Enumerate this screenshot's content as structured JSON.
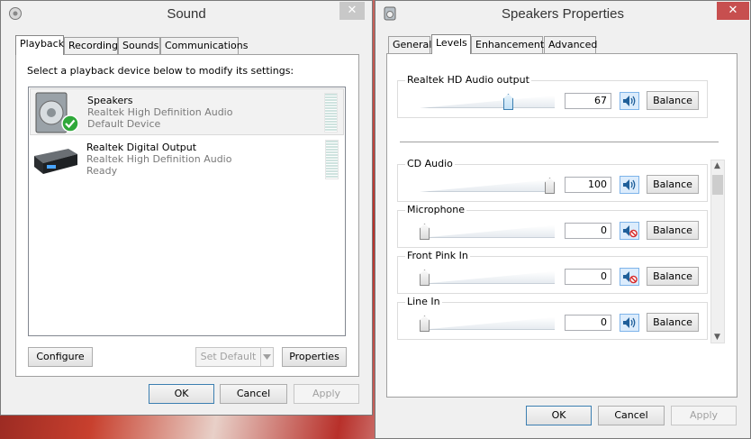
{
  "sound": {
    "title": "Sound",
    "close": "✕",
    "tabs": [
      "Playback",
      "Recording",
      "Sounds",
      "Communications"
    ],
    "instruction": "Select a playback device below to modify its settings:",
    "devices": [
      {
        "name": "Speakers",
        "line1": "Realtek High Definition Audio",
        "line2": "Default Device"
      },
      {
        "name": "Realtek Digital Output",
        "line1": "Realtek High Definition Audio",
        "line2": "Ready"
      }
    ],
    "configure": "Configure",
    "set_default": "Set Default",
    "properties": "Properties",
    "ok": "OK",
    "cancel": "Cancel",
    "apply": "Apply"
  },
  "speakers": {
    "title": "Speakers Properties",
    "close": "✕",
    "tabs": [
      "General",
      "Levels",
      "Enhancements",
      "Advanced"
    ],
    "controls": [
      {
        "label": "Realtek HD Audio output",
        "value": "67",
        "level": 0.67,
        "muted": false,
        "balance": "Balance"
      },
      {
        "label": "CD Audio",
        "value": "100",
        "level": 1.0,
        "muted": false,
        "balance": "Balance"
      },
      {
        "label": "Microphone",
        "value": "0",
        "level": 0,
        "muted": true,
        "balance": "Balance"
      },
      {
        "label": "Front Pink In",
        "value": "0",
        "level": 0,
        "muted": true,
        "balance": "Balance"
      },
      {
        "label": "Line In",
        "value": "0",
        "level": 0,
        "muted": false,
        "balance": "Balance"
      }
    ],
    "ok": "OK",
    "cancel": "Cancel",
    "apply": "Apply"
  },
  "colors": {
    "accent": "#3c7fb1",
    "mute_red": "#d62b2b",
    "check_green": "#2fa83a"
  }
}
